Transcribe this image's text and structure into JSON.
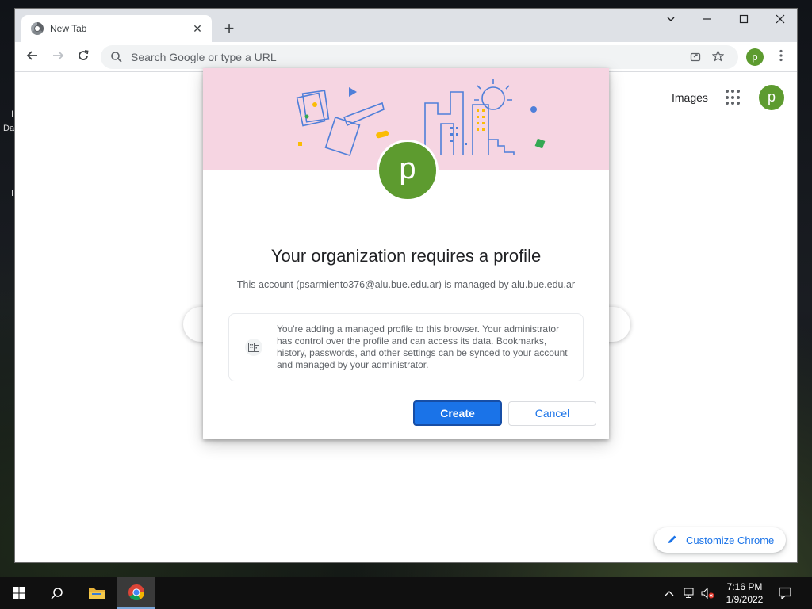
{
  "window": {
    "tab_title": "New Tab",
    "tab_close": "✕",
    "new_tab": "+",
    "controls": {
      "dropdown": "⌄",
      "minimize": "—",
      "maximize": "☐",
      "close": "✕"
    }
  },
  "toolbar": {
    "back": "←",
    "forward": "→",
    "reload": "↻",
    "omnibox_placeholder": "Search Google or type a URL",
    "share_icon": "share-icon",
    "bookmark_icon": "star-icon",
    "profile_initial": "p",
    "menu": "⋮"
  },
  "ntp": {
    "images_link": "Images",
    "avatar_initial": "p",
    "customize_label": "Customize Chrome"
  },
  "dialog": {
    "avatar_initial": "p",
    "title": "Your organization requires a profile",
    "subtitle": "This account (psarmiento376@alu.bue.edu.ar) is managed by alu.bue.edu.ar",
    "notice": "You're adding a managed profile to this browser. Your administrator has control over the profile and can access its data. Bookmarks, history, passwords, and other settings can be synced to your account and managed by your administrator.",
    "create_label": "Create",
    "cancel_label": "Cancel"
  },
  "taskbar": {
    "time": "7:16 PM",
    "date": "1/9/2022"
  },
  "colors": {
    "accent": "#1a73e8",
    "avatar": "#5d9b2f",
    "banner": "#f6d5e2"
  }
}
